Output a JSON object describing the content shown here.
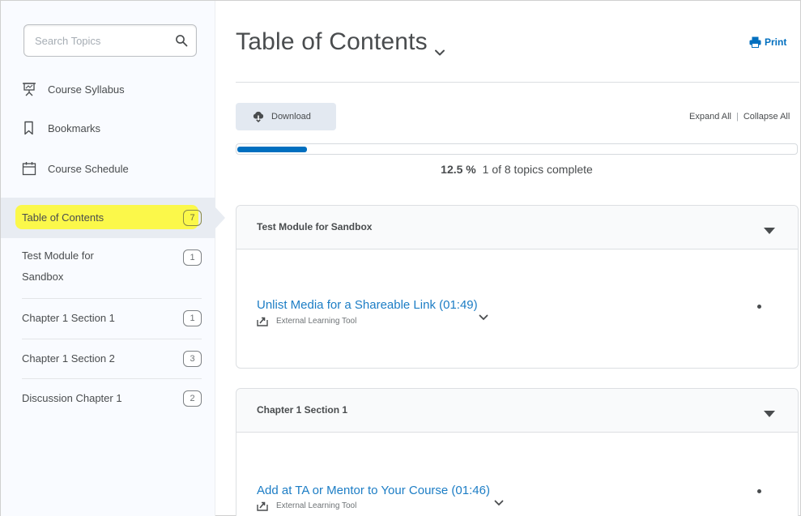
{
  "sidebar": {
    "search": {
      "placeholder": "Search Topics",
      "value": ""
    },
    "links": [
      {
        "label": "Course Syllabus",
        "icon": "presentation-icon"
      },
      {
        "label": "Bookmarks",
        "icon": "bookmark-icon"
      },
      {
        "label": "Course Schedule",
        "icon": "calendar-icon"
      }
    ],
    "toc": {
      "label": "Table of Contents",
      "count": "7"
    },
    "modules": [
      {
        "label_line1": "Test Module for",
        "label_line2": "Sandbox",
        "count": "1"
      },
      {
        "label": "Chapter 1 Section 1",
        "count": "1"
      },
      {
        "label": "Chapter 1 Section 2",
        "count": "3"
      },
      {
        "label": "Discussion Chapter 1",
        "count": "2"
      }
    ]
  },
  "main": {
    "title": "Table of Contents",
    "print_label": "Print",
    "download_label": "Download",
    "expand_all": "Expand All",
    "separator": "|",
    "collapse_all": "Collapse All",
    "progress": {
      "percent_text": "12.5 %",
      "summary": "1 of 8 topics complete",
      "fraction": 0.125
    },
    "cards": [
      {
        "title": "Test Module for Sandbox",
        "topic": {
          "title": "Unlist Media for a Shareable Link (01:49)",
          "type": "External Learning Tool"
        }
      },
      {
        "title": "Chapter 1 Section 1",
        "topic": {
          "title": "Add at TA or Mentor to Your Course (01:46)",
          "type": "External Learning Tool"
        }
      }
    ]
  },
  "colors": {
    "accent": "#006fbf",
    "link": "#1c7dc5",
    "highlight": "#fbf84a",
    "text": "#494c4e"
  }
}
